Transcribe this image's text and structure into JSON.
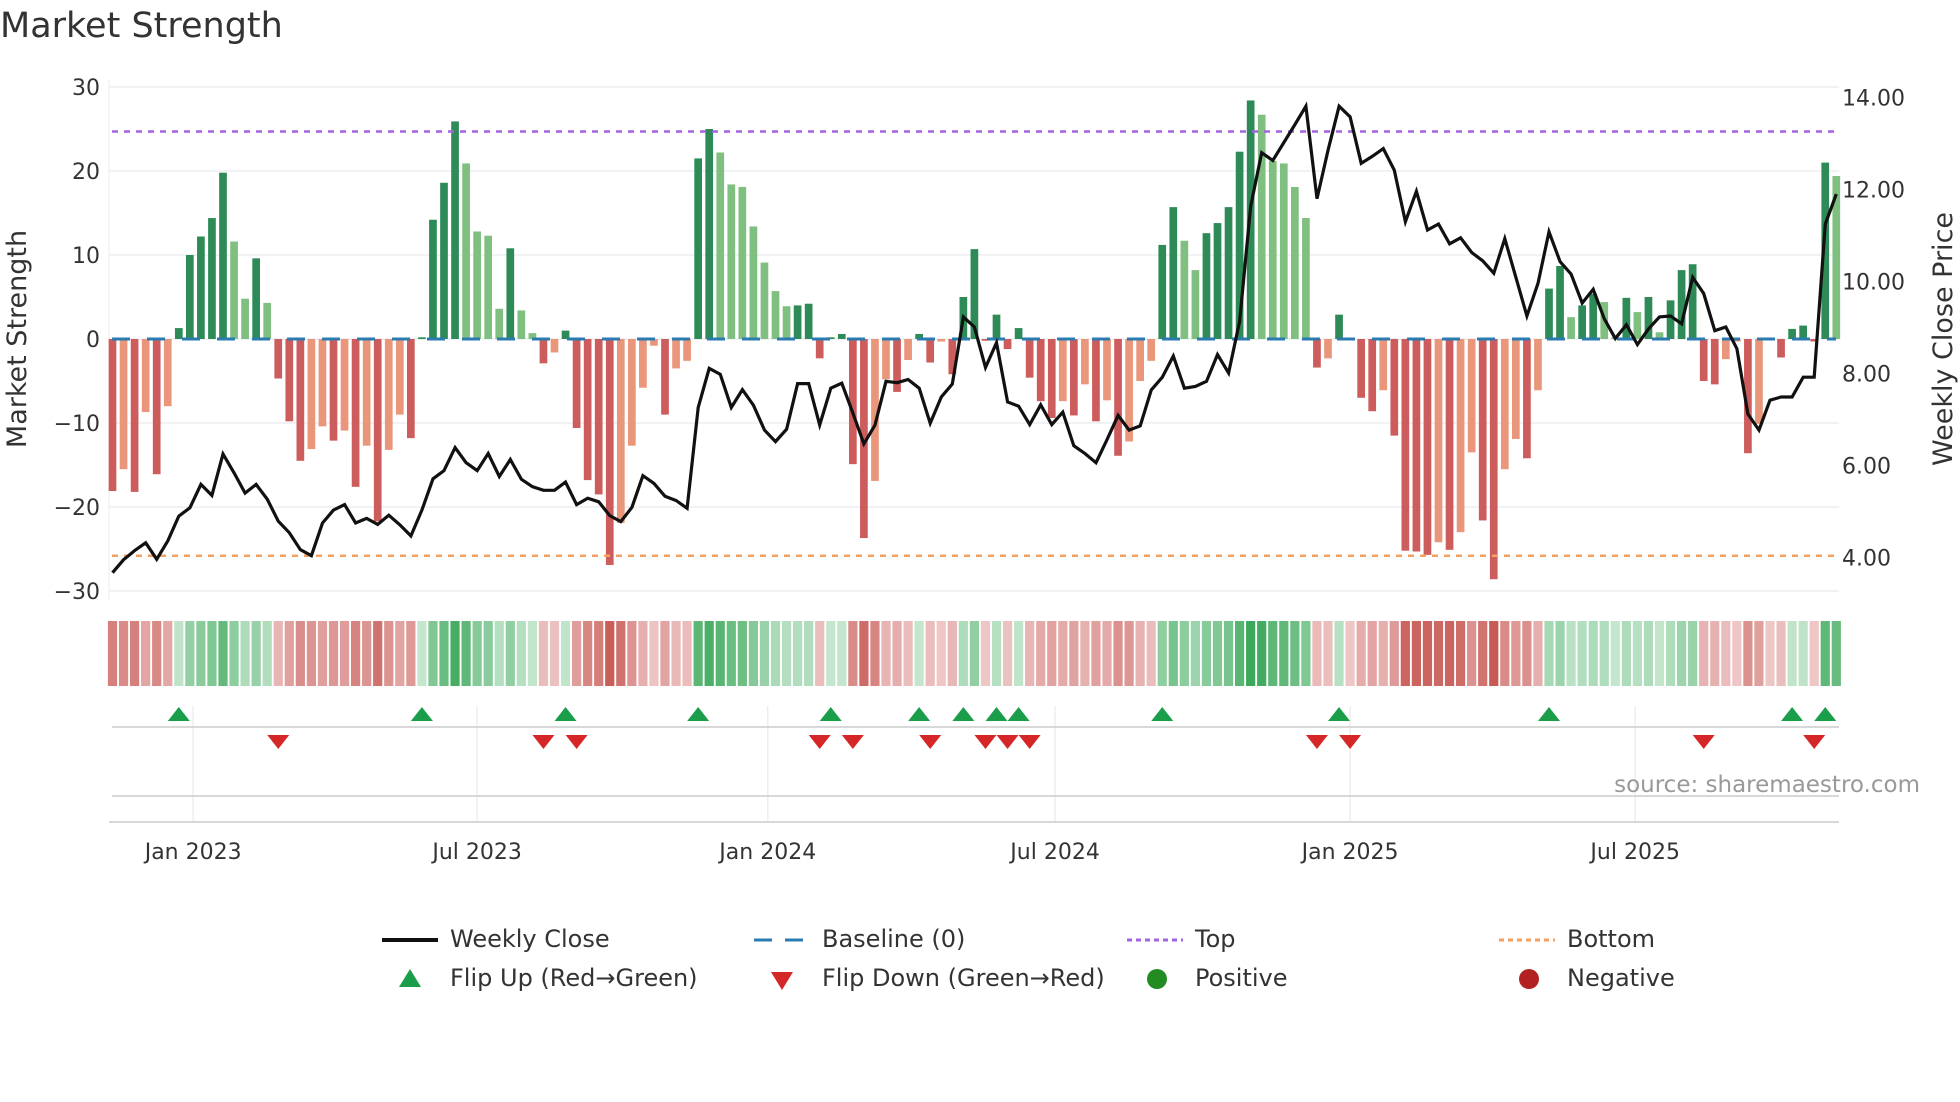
{
  "title": "Market Strength",
  "source": "source: sharemaestro.com",
  "colors": {
    "strong_green": "#2e8b57",
    "weak_green": "#7fbf7f",
    "strong_red": "#cd5c5c",
    "weak_red": "#e9967a",
    "close": "#111111",
    "baseline": "#2b7bb0",
    "top": "#a463e0",
    "bottom": "#f4a261",
    "flip_up": "#1a9e4a",
    "flip_down": "#d62728",
    "positive": "#228b22",
    "negative": "#b22222"
  },
  "legend": {
    "weekly_close": "Weekly Close",
    "baseline": "Baseline (0)",
    "top": "Top",
    "bottom": "Bottom",
    "flip_up": "Flip Up (Red→Green)",
    "flip_down": "Flip Down (Green→Red)",
    "positive": "Positive",
    "negative": "Negative"
  },
  "chart_data": {
    "type": "bar",
    "title": "Market Strength",
    "ylabel": "Market Strength",
    "y2label": "Weekly Close Price",
    "ylim": [
      -31,
      31
    ],
    "y2lim": [
      2.9,
      14.5
    ],
    "yticks": [
      {
        "v": 30,
        "label": "30"
      },
      {
        "v": 20,
        "label": "20"
      },
      {
        "v": 10,
        "label": "10"
      },
      {
        "v": 0,
        "label": "0"
      },
      {
        "v": -10,
        "label": "−10"
      },
      {
        "v": -20,
        "label": "−20"
      },
      {
        "v": -30,
        "label": "−30"
      }
    ],
    "y2ticks": [
      {
        "v": 14,
        "label": "14.00"
      },
      {
        "v": 12,
        "label": "12.00"
      },
      {
        "v": 10,
        "label": "10.00"
      },
      {
        "v": 8,
        "label": "8.00"
      },
      {
        "v": 6,
        "label": "6.00"
      },
      {
        "v": 4,
        "label": "4.00"
      }
    ],
    "xticks": [
      {
        "week": 7.3,
        "label": "Jan 2023"
      },
      {
        "week": 33.0,
        "label": "Jul 2023"
      },
      {
        "week": 59.3,
        "label": "Jan 2024"
      },
      {
        "week": 85.3,
        "label": "Jul 2024"
      },
      {
        "week": 112.0,
        "label": "Jan 2025"
      },
      {
        "week": 137.8,
        "label": "Jul 2025"
      }
    ],
    "top_level": 24.7,
    "bottom_level": -25.8,
    "strength": [
      -18.1,
      -15.5,
      -18.2,
      -8.7,
      -16.1,
      -8,
      1.3,
      10,
      12.2,
      14.4,
      19.8,
      11.6,
      4.8,
      9.6,
      4.3,
      -4.7,
      -9.8,
      -14.5,
      -13.1,
      -10.4,
      -12.1,
      -10.9,
      -17.6,
      -12.7,
      -21.7,
      -13.2,
      -9,
      -11.8,
      0.2,
      14.2,
      18.6,
      25.9,
      20.9,
      12.8,
      12.3,
      3.6,
      10.8,
      3.4,
      0.7,
      -2.9,
      -1.6,
      1.0,
      -10.6,
      -16.8,
      -18.5,
      -26.9,
      -21.9,
      -12.7,
      -5.8,
      -0.8,
      -9,
      -3.5,
      -2.6,
      21.5,
      25,
      22.2,
      18.4,
      18.1,
      13.4,
      9.1,
      5.7,
      3.9,
      4,
      4.2,
      -2.3,
      0.2,
      0.6,
      -14.9,
      -23.7,
      -16.9,
      -4.8,
      -6.3,
      -2.5,
      0.6,
      -2.8,
      -0.3,
      -4.2,
      5,
      10.7,
      -0.2,
      2.9,
      -1.2,
      1.3,
      -4.6,
      -7.4,
      -9.4,
      -7.4,
      -9.1,
      -5.4,
      -9.8,
      -7.3,
      -13.9,
      -12.2,
      -5,
      -2.6,
      11.2,
      15.7,
      11.7,
      8.2,
      12.6,
      13.8,
      15.7,
      22.3,
      28.4,
      26.7,
      21.2,
      20.9,
      18.1,
      14.4,
      -3.4,
      -2.3,
      2.9,
      -0.1,
      -7,
      -8.6,
      -6.1,
      -11.5,
      -25.2,
      -25.3,
      -25.7,
      -24.2,
      -25.1,
      -23,
      -13.5,
      -21.6,
      -28.6,
      -15.5,
      -11.9,
      -14.2,
      -6.1,
      6,
      8.7,
      2.6,
      4,
      5.4,
      4.4,
      0.2,
      4.9,
      3.2,
      5,
      0.8,
      4.6,
      8.2,
      8.9,
      -5,
      -5.4,
      -2.4,
      -0.3,
      -13.6,
      -10.1,
      -0.1,
      -2.2,
      1.2,
      1.6,
      -0.3,
      21,
      19.4
    ],
    "weekly_close": [
      3.67,
      3.95,
      4.15,
      4.32,
      3.96,
      4.36,
      4.9,
      5.08,
      5.59,
      5.35,
      6.25,
      5.84,
      5.4,
      5.59,
      5.27,
      4.79,
      4.54,
      4.17,
      4.04,
      4.75,
      5.03,
      5.15,
      4.75,
      4.85,
      4.72,
      4.92,
      4.71,
      4.47,
      5.03,
      5.71,
      5.89,
      6.39,
      6.06,
      5.89,
      6.26,
      5.76,
      6.13,
      5.7,
      5.54,
      5.46,
      5.46,
      5.64,
      5.15,
      5.29,
      5.21,
      4.91,
      4.78,
      5.09,
      5.78,
      5.61,
      5.33,
      5.24,
      5.07,
      7.26,
      8.11,
      7.98,
      7.26,
      7.65,
      7.31,
      6.77,
      6.52,
      6.79,
      7.78,
      7.78,
      6.88,
      7.68,
      7.79,
      7.14,
      6.47,
      6.88,
      7.83,
      7.8,
      7.87,
      7.68,
      6.92,
      7.49,
      7.77,
      9.23,
      9.01,
      8.13,
      8.67,
      7.38,
      7.29,
      6.89,
      7.32,
      6.89,
      7.16,
      6.43,
      6.26,
      6.06,
      6.56,
      7.09,
      6.77,
      6.86,
      7.64,
      7.92,
      8.38,
      7.68,
      7.72,
      7.83,
      8.41,
      8.01,
      9.13,
      11.64,
      12.8,
      12.63,
      13.02,
      13.41,
      13.81,
      11.8,
      12.85,
      13.81,
      13.58,
      12.57,
      12.72,
      12.89,
      12.42,
      11.3,
      11.96,
      11.12,
      11.25,
      10.82,
      10.95,
      10.63,
      10.45,
      10.18,
      10.93,
      10.09,
      9.25,
      9.96,
      11.08,
      10.43,
      10.16,
      9.53,
      9.83,
      9.19,
      8.76,
      9.06,
      8.63,
      8.97,
      9.23,
      9.25,
      9.08,
      10.09,
      9.74,
      8.93,
      9.01,
      8.54,
      7.12,
      6.77,
      7.42,
      7.49,
      7.49,
      7.92,
      7.92,
      11.25,
      11.9
    ],
    "flip_up_weeks": [
      6,
      28,
      41,
      53,
      65,
      73,
      77,
      80,
      82,
      95,
      111,
      130,
      152,
      155
    ],
    "flip_down_weeks": [
      15,
      39,
      42,
      64,
      67,
      74,
      79,
      81,
      83,
      109,
      112,
      144,
      154
    ]
  }
}
